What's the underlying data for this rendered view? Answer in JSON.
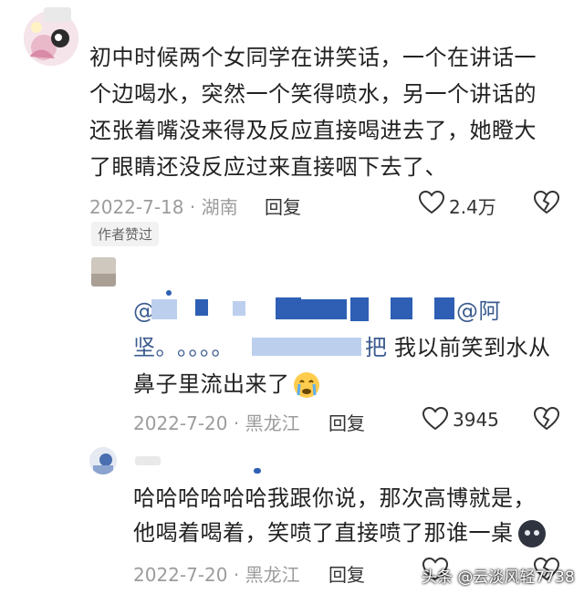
{
  "comments": [
    {
      "text_lines": [
        "初中时候两个女同学在讲笑话，一个在讲话一",
        "个边喝水，突然一个笑得喷水，另一个讲话的",
        "还张着嘴没来得及反应直接喝进去了，她瞪大",
        "了眼睛还没反应过来直接咽下去了、"
      ],
      "date_loc": "2022-7-18 · 湖南",
      "reply_label": "回复",
      "like_count": "2.4万",
      "badge": "作者赞过"
    },
    {
      "mention_start": "@",
      "mention_end": "@阿",
      "line2_start": "坚。",
      "line2_dots": "。。。。",
      "line2_mid": "把",
      "line2_end": "我以前笑到水从",
      "line3": "鼻子里流出来了",
      "date_loc": "2022-7-20 · 黑龙江",
      "reply_label": "回复",
      "like_count": "3945"
    },
    {
      "text_lines": [
        "哈哈哈哈哈哈我跟你说，那次高博就是，",
        "他喝着喝着，笑喷了直接喷了那谁一桌"
      ],
      "date_loc": "2022-7-20 · 黑龙江",
      "reply_label": "回复"
    }
  ],
  "watermark": "头条 @云淡风轻7738",
  "colors": {
    "meta_gray": "#9c9c9c",
    "mention_blue": "#3b5b8f",
    "redaction_blue": "#2e5fb4"
  },
  "icons": [
    "heart-outline-icon",
    "broken-heart-icon",
    "crying-face-emoji",
    "dark-face-emoji"
  ]
}
